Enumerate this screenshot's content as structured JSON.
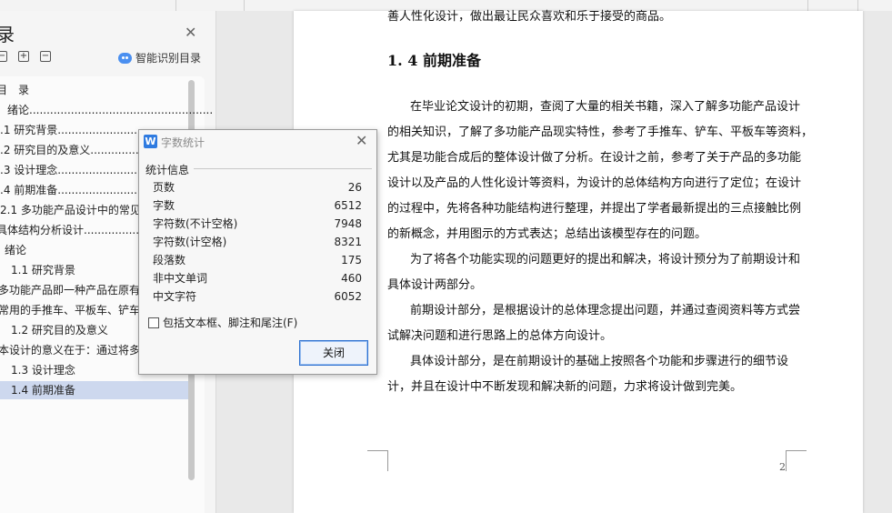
{
  "nav": {
    "title": "录",
    "smart_toc_label": "智能识别目录",
    "toc_items": [
      {
        "text": "目　录"
      },
      {
        "text": "绪论....................................................."
      },
      {
        "text": ".1  研究背景..........................................."
      },
      {
        "text": ".2  研究目的及意义..................................."
      },
      {
        "text": ".3  设计理念..........................................."
      },
      {
        "text": ".4  前期准备..........................................."
      },
      {
        "text": "2.1  多功能产品设计中的常见"
      },
      {
        "text": "  具体结构分析设计......................................"
      },
      {
        "text": "绪论"
      },
      {
        "text": "1.1  研究背景"
      },
      {
        "text": "多功能产品即一种产品在原有"
      },
      {
        "text": "常用的手推车、平板车、铲车"
      },
      {
        "text": "1.2  研究目的及意义"
      },
      {
        "text": "本设计的意义在于：通过将多"
      },
      {
        "text": "1.3  设计理念"
      },
      {
        "text": "1.4 前期准备"
      }
    ]
  },
  "document": {
    "top_line": "善人性化设计，做出最让民众喜欢和乐于接受的商品。",
    "heading": "1. 4 前期准备",
    "lines": [
      "在毕业论文设计的初期，查阅了大量的相关书籍，深入了解多功能产品设计",
      "的相关知识，了解了多功能产品现实特性，参考了手推车、铲车、平板车等资料，",
      "尤其是功能合成后的整体设计做了分析。在设计之前，参考了关于产品的多功能",
      "设计以及产品的人性化设计等资料，为设计的总体结构方向进行了定位；在设计",
      "的过程中，先将各种功能结构进行整理，并提出了学者最新提出的三点接触比例",
      "的新概念，并用图示的方式表达；总结出该模型存在的问题。",
      "为了将各个功能实现的问题更好的提出和解决，将设计预分为了前期设计和",
      "具体设计两部分。",
      "前期设计部分，是根据设计的总体理念提出问题，并通过查阅资料等方式尝",
      "试解决问题和进行思路上的总体方向设计。",
      "具体设计部分，是在前期设计的基础上按照各个功能和步骤进行的细节设",
      "计，并且在设计中不断发现和解决新的问题，力求将设计做到完美。"
    ],
    "page_number": "2"
  },
  "dialog": {
    "icon_letter": "W",
    "title": "字数统计",
    "group_label": "统计信息",
    "stats": [
      {
        "label": "页数",
        "value": "26"
      },
      {
        "label": "字数",
        "value": "6512"
      },
      {
        "label": "字符数(不计空格)",
        "value": "7948"
      },
      {
        "label": "字符数(计空格)",
        "value": "8321"
      },
      {
        "label": "段落数",
        "value": "175"
      },
      {
        "label": "非中文单词",
        "value": "460"
      },
      {
        "label": "中文字符",
        "value": "6052"
      }
    ],
    "checkbox_label": "包括文本框、脚注和尾注(F)",
    "close_label": "关闭"
  }
}
